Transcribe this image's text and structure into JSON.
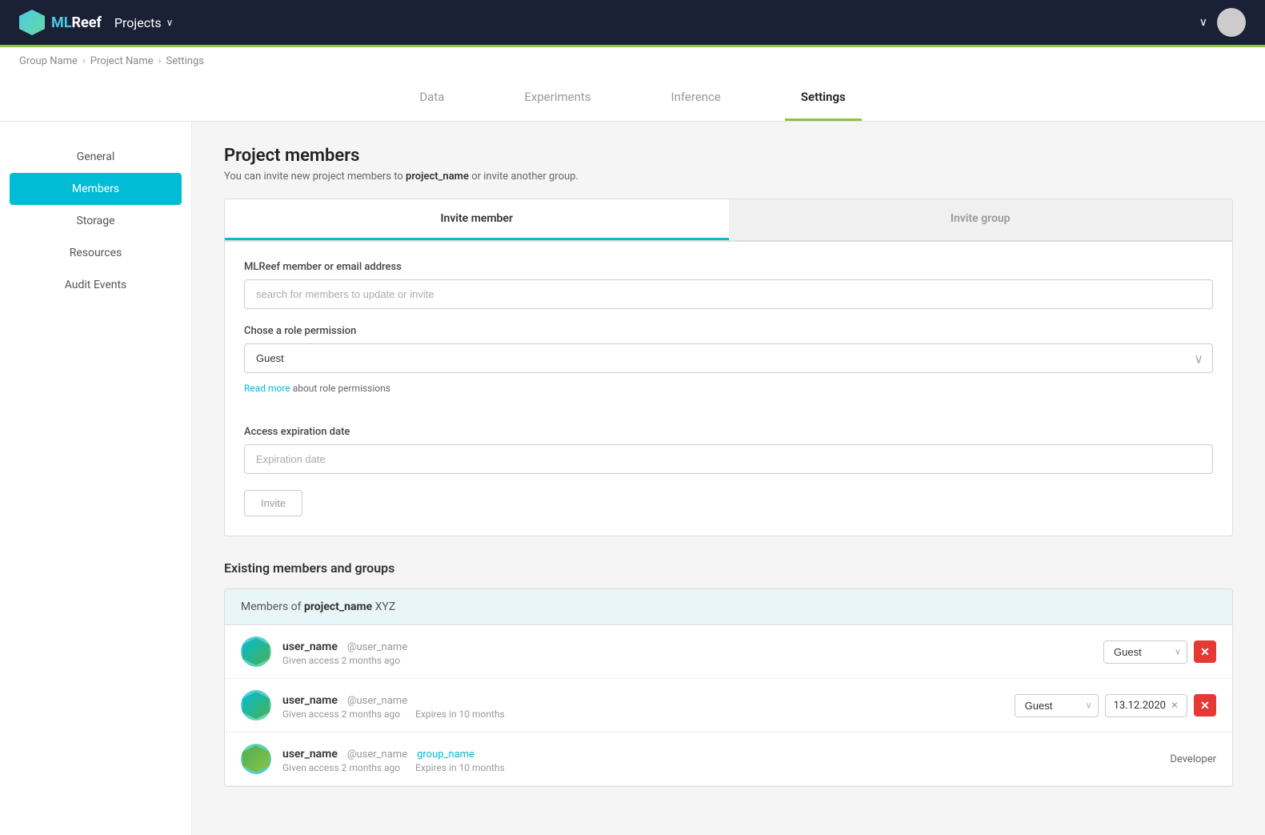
{
  "nav": {
    "logo_ml": "ML",
    "logo_reef": "Reef",
    "projects_label": "Projects",
    "chevron_down": "∨",
    "nav_chevron": "∨"
  },
  "breadcrumb": {
    "group": "Group Name",
    "project": "Project Name",
    "current": "Settings"
  },
  "tabs": [
    {
      "id": "data",
      "label": "Data",
      "active": false
    },
    {
      "id": "experiments",
      "label": "Experiments",
      "active": false
    },
    {
      "id": "inference",
      "label": "Inference",
      "active": false
    },
    {
      "id": "settings",
      "label": "Settings",
      "active": true
    }
  ],
  "sidebar": {
    "items": [
      {
        "id": "general",
        "label": "General",
        "active": false
      },
      {
        "id": "members",
        "label": "Members",
        "active": true
      },
      {
        "id": "storage",
        "label": "Storage",
        "active": false
      },
      {
        "id": "resources",
        "label": "Resources",
        "active": false
      },
      {
        "id": "audit-events",
        "label": "Audit Events",
        "active": false
      }
    ]
  },
  "content": {
    "page_title": "Project members",
    "page_desc_prefix": "You can invite new project members to ",
    "project_name": "project_name",
    "page_desc_suffix": " or invite another group.",
    "invite_tabs": [
      {
        "id": "invite-member",
        "label": "Invite member",
        "active": true
      },
      {
        "id": "invite-group",
        "label": "Invite group",
        "active": false
      }
    ],
    "member_email_label": "MLReef member or email address",
    "member_email_placeholder": "search for members to update or invite",
    "role_label": "Chose a role permission",
    "role_default": "Guest",
    "read_more_link": "Read more",
    "read_more_text": " about role permissions",
    "expiration_label": "Access expiration date",
    "expiration_placeholder": "Expiration date",
    "invite_button": "Invite",
    "existing_title": "Existing members and groups",
    "members_header_prefix": "Members of ",
    "members_project": "project_name",
    "members_header_suffix": "  XYZ",
    "members": [
      {
        "id": 1,
        "name": "user_name",
        "handle": "@user_name",
        "handle_type": "plain",
        "access_info": "Given access 2 months ago",
        "expires": "",
        "role": "Guest",
        "has_expiry": false,
        "remove": true
      },
      {
        "id": 2,
        "name": "user_name",
        "handle": "@user_name",
        "handle_type": "plain",
        "access_info": "Given access 2 months ago",
        "expires": "Expires in 10 months",
        "role": "Guest",
        "has_expiry": true,
        "expiry_date": "13.12.2020",
        "remove": true
      },
      {
        "id": 3,
        "name": "user_name",
        "handle": "@user_name",
        "handle_type": "link",
        "handle_link": "group_name",
        "access_info": "Given access 2 months ago",
        "expires": "Expires in 10 months",
        "role": "Developer",
        "has_expiry": false,
        "remove": false
      }
    ]
  }
}
